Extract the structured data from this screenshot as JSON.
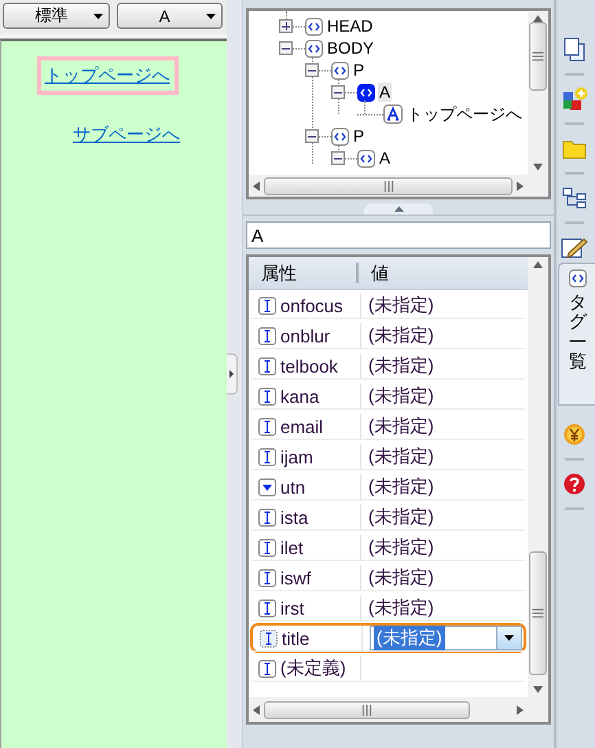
{
  "toolbar": {
    "dropdowns": [
      {
        "value": "標準"
      },
      {
        "value": "A"
      }
    ]
  },
  "preview": {
    "links": [
      {
        "text": "トップページへ",
        "selected": true
      },
      {
        "text": "サブページへ",
        "selected": false
      }
    ]
  },
  "tree": {
    "nodes": [
      {
        "label": "HEAD",
        "kind": "tag",
        "expanded": false,
        "selected": false
      },
      {
        "label": "BODY",
        "kind": "tag",
        "expanded": true,
        "selected": false,
        "children": [
          {
            "label": "P",
            "kind": "tag",
            "expanded": true,
            "selected": false,
            "children": [
              {
                "label": "A",
                "kind": "tag",
                "expanded": true,
                "selected": true,
                "children": [
                  {
                    "label": "トップページへ",
                    "kind": "text",
                    "selected": false
                  }
                ]
              }
            ]
          },
          {
            "label": "P",
            "kind": "tag",
            "expanded": true,
            "selected": false,
            "children": [
              {
                "label": "A",
                "kind": "tag",
                "expanded": true,
                "selected": false
              }
            ]
          }
        ]
      }
    ]
  },
  "tag_field": {
    "value": "A"
  },
  "attributes": {
    "columns": [
      "属性",
      "値"
    ],
    "rows": [
      {
        "name": "onfocus",
        "value": "(未指定)",
        "kind": "text",
        "selected": false
      },
      {
        "name": "onblur",
        "value": "(未指定)",
        "kind": "text",
        "selected": false
      },
      {
        "name": "telbook",
        "value": "(未指定)",
        "kind": "text",
        "selected": false
      },
      {
        "name": "kana",
        "value": "(未指定)",
        "kind": "text",
        "selected": false
      },
      {
        "name": "email",
        "value": "(未指定)",
        "kind": "text",
        "selected": false
      },
      {
        "name": "ijam",
        "value": "(未指定)",
        "kind": "text",
        "selected": false
      },
      {
        "name": "utn",
        "value": "(未指定)",
        "kind": "list",
        "selected": false
      },
      {
        "name": "ista",
        "value": "(未指定)",
        "kind": "text",
        "selected": false
      },
      {
        "name": "ilet",
        "value": "(未指定)",
        "kind": "text",
        "selected": false
      },
      {
        "name": "iswf",
        "value": "(未指定)",
        "kind": "text",
        "selected": false
      },
      {
        "name": "irst",
        "value": "(未指定)",
        "kind": "text",
        "selected": false
      },
      {
        "name": "title",
        "value": "(未指定)",
        "kind": "text",
        "selected": true
      },
      {
        "name": "(未定義)",
        "kind": "text",
        "selected": false
      }
    ]
  },
  "sidebar": {
    "tab": {
      "label": "タグ一覧",
      "selected": true
    }
  }
}
